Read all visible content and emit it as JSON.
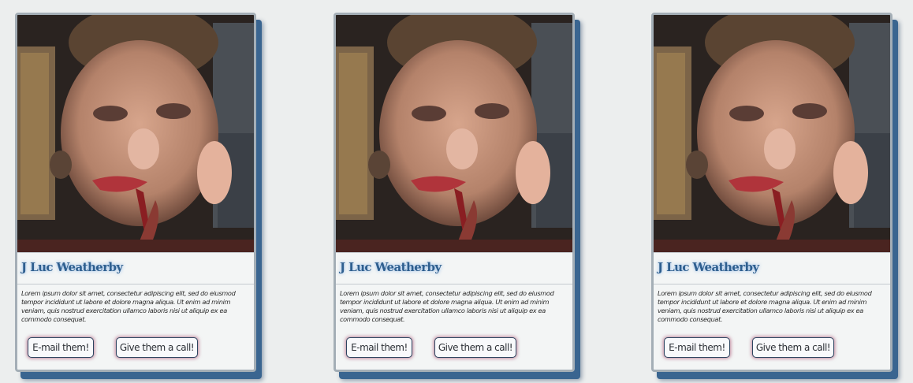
{
  "cards": [
    {
      "name": "J Luc Weatherby",
      "description": "Lorem ipsum dolor sit amet, consectetur adipiscing elit, sed do eiusmod tempor incididunt ut labore et dolore magna aliqua. Ut enim ad minim veniam, quis nostrud exercitation ullamco laboris nisi ut aliquip ex ea commodo consequat.",
      "email_label": "E-mail them!",
      "call_label": "Give them a call!"
    },
    {
      "name": "J Luc Weatherby",
      "description": "Lorem ipsum dolor sit amet, consectetur adipiscing elit, sed do eiusmod tempor incididunt ut labore et dolore magna aliqua. Ut enim ad minim veniam, quis nostrud exercitation ullamco laboris nisi ut aliquip ex ea commodo consequat.",
      "email_label": "E-mail them!",
      "call_label": "Give them a call!"
    },
    {
      "name": "J Luc Weatherby",
      "description": "Lorem ipsum dolor sit amet, consectetur adipiscing elit, sed do eiusmod tempor incididunt ut labore et dolore magna aliqua. Ut enim ad minim veniam, quis nostrud exercitation ullamco laboris nisi ut aliquip ex ea commodo consequat.",
      "email_label": "E-mail them!",
      "call_label": "Give them a call!"
    }
  ],
  "colors": {
    "page_background": "#eceeee",
    "card_background": "#f3f5f5",
    "card_shadow": "#3a6590",
    "name_color": "#2f5f8f",
    "button_border": "#2c4560"
  }
}
